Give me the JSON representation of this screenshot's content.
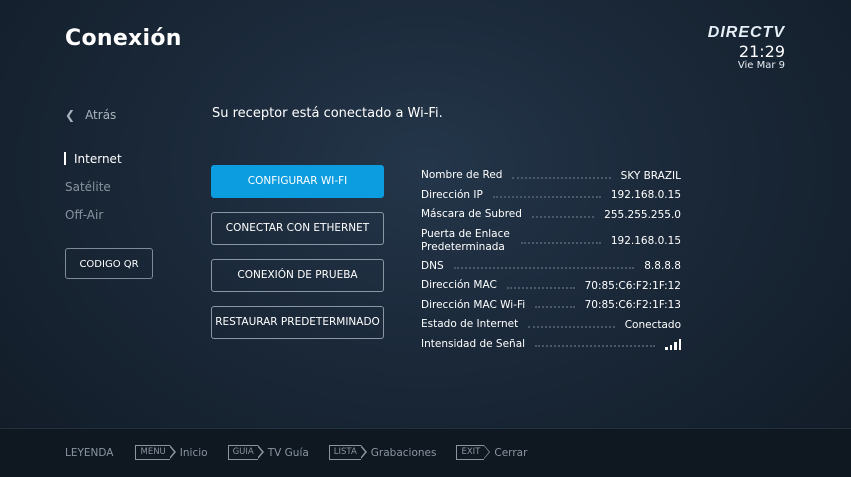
{
  "header": {
    "title": "Conexión",
    "logo": "DIRECTV",
    "time": "21:29",
    "date": "Vie Mar 9"
  },
  "back": {
    "label": "Atrás"
  },
  "nav": {
    "items": [
      {
        "label": "Internet"
      },
      {
        "label": "Satélite"
      },
      {
        "label": "Off-Air"
      }
    ]
  },
  "qr_button": "CODIGO QR",
  "status_message": "Su receptor está conectado a Wi-Fi.",
  "buttons": [
    {
      "label": "CONFIGURAR WI-FI"
    },
    {
      "label": "CONECTAR CON ETHERNET"
    },
    {
      "label": "CONEXIÓN DE PRUEBA"
    },
    {
      "label": "RESTAURAR PREDETERMINADO"
    }
  ],
  "info": [
    {
      "label": "Nombre de Red",
      "value": "SKY BRAZIL"
    },
    {
      "label": "Dirección IP",
      "value": "192.168.0.15"
    },
    {
      "label": "Máscara de Subred",
      "value": "255.255.255.0"
    },
    {
      "label": "Puerta de Enlace Predeterminada",
      "value": "192.168.0.15"
    },
    {
      "label": "DNS",
      "value": "8.8.8.8"
    },
    {
      "label": "Dirección MAC",
      "value": "70:85:C6:F2:1F:12"
    },
    {
      "label": "Dirección MAC Wi-Fi",
      "value": "70:85:C6:F2:1F:13"
    },
    {
      "label": "Estado de Internet",
      "value": "Conectado"
    },
    {
      "label": "Intensidad de Señal",
      "signal_bars": 4
    }
  ],
  "footer": {
    "legend": "LEYENDA",
    "keys": [
      {
        "key": "MENU",
        "label": "Inicio"
      },
      {
        "key": "GUIA",
        "label": "TV Guía"
      },
      {
        "key": "LISTA",
        "label": "Grabaciones"
      },
      {
        "key": "EXIT",
        "label": "Cerrar"
      }
    ]
  }
}
